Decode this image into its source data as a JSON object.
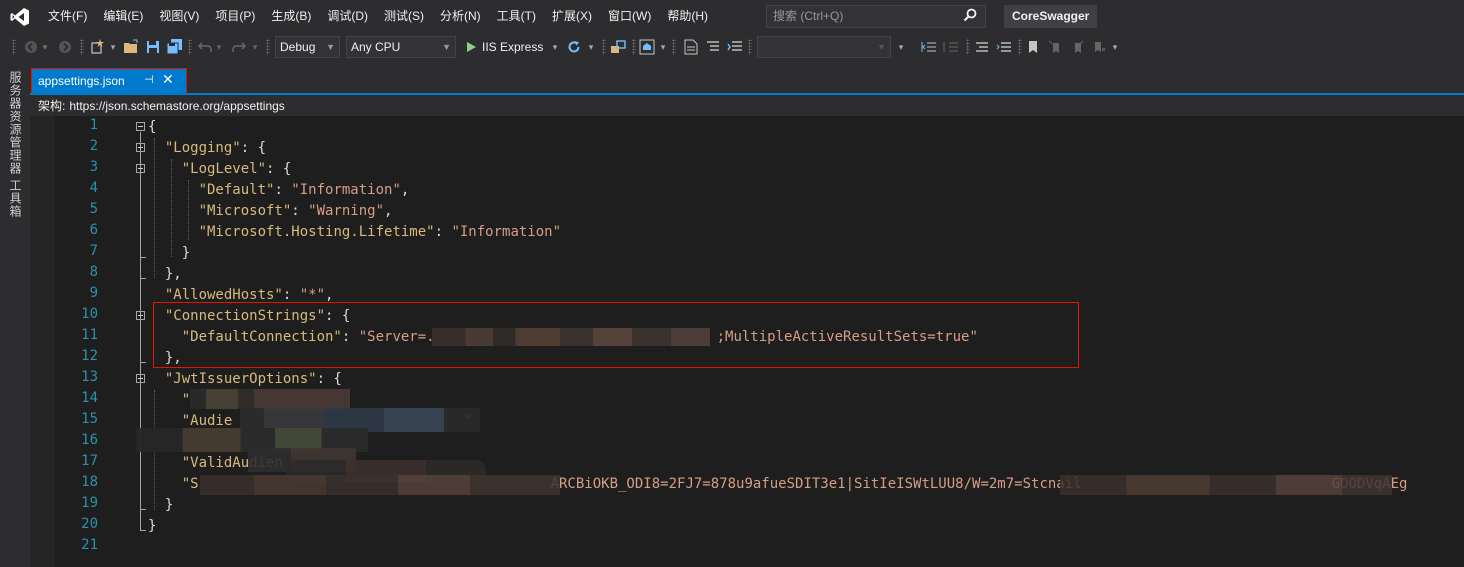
{
  "menu": {
    "items": [
      "文件(F)",
      "编辑(E)",
      "视图(V)",
      "项目(P)",
      "生成(B)",
      "调试(D)",
      "测试(S)",
      "分析(N)",
      "工具(T)",
      "扩展(X)",
      "窗口(W)",
      "帮助(H)"
    ],
    "search_placeholder": "搜索 (Ctrl+Q)",
    "project_name": "CoreSwagger"
  },
  "toolbar": {
    "configuration": "Debug",
    "platform": "Any CPU",
    "run_target": "IIS Express"
  },
  "left_strip": {
    "items": [
      "服务器资源管理器",
      "工具箱"
    ]
  },
  "tab": {
    "title": "appsettings.json",
    "pin_glyph": "⊣",
    "close_glyph": "✕"
  },
  "schema": {
    "label": "架构:",
    "value": "https://json.schemastore.org/appsettings"
  },
  "editor": {
    "line_numbers": [
      "1",
      "2",
      "3",
      "4",
      "5",
      "6",
      "7",
      "8",
      "9",
      "10",
      "11",
      "12",
      "13",
      "14",
      "15",
      "16",
      "17",
      "18",
      "19",
      "20",
      "21"
    ],
    "lines": {
      "l1": {
        "p1": "{"
      },
      "l2": {
        "k": "\"Logging\"",
        "p1": ": {"
      },
      "l3": {
        "k": "\"LogLevel\"",
        "p1": ": {"
      },
      "l4": {
        "k": "\"Default\"",
        "p1": ": ",
        "s": "\"Information\"",
        "p2": ","
      },
      "l5": {
        "k": "\"Microsoft\"",
        "p1": ": ",
        "s": "\"Warning\"",
        "p2": ","
      },
      "l6": {
        "k": "\"Microsoft.Hosting.Lifetime\"",
        "p1": ": ",
        "s": "\"Information\""
      },
      "l7": {
        "p1": "}"
      },
      "l8": {
        "p1": "},"
      },
      "l9": {
        "k": "\"AllowedHosts\"",
        "p1": ": ",
        "s": "\"*\"",
        "p2": ","
      },
      "l10": {
        "k": "\"ConnectionStrings\"",
        "p1": ": {"
      },
      "l11": {
        "k": "\"DefaultConnection\"",
        "p1": ": ",
        "s": "\"Server=.",
        "s2": ";MultipleActiveResultSets=true\""
      },
      "l12": {
        "p1": "},"
      },
      "l13": {
        "k": "\"JwtIssuerOptions\"",
        "p1": ": {"
      },
      "l14": {
        "k": "\""
      },
      "l15": {
        "k": "\"Audie",
        "s": "\""
      },
      "l16": {},
      "l17": {
        "k": "\"ValidAudien"
      },
      "l18": {
        "k": "\"S",
        "s": "ARCBiOKB_ODI8=2FJ7=878u9afueSDIT3e1|SitIeISWtLUU8/W=2m7=Stcnail",
        "s2": "GOODVqAEg"
      },
      "l19": {
        "p1": "}"
      },
      "l20": {
        "p1": "}"
      },
      "l21": {}
    }
  },
  "colors": {
    "accent": "#007acc",
    "highlight_border": "#e51400",
    "line_number": "#2b91af",
    "json_key": "#d7ba7d",
    "json_string": "#d69d85"
  }
}
